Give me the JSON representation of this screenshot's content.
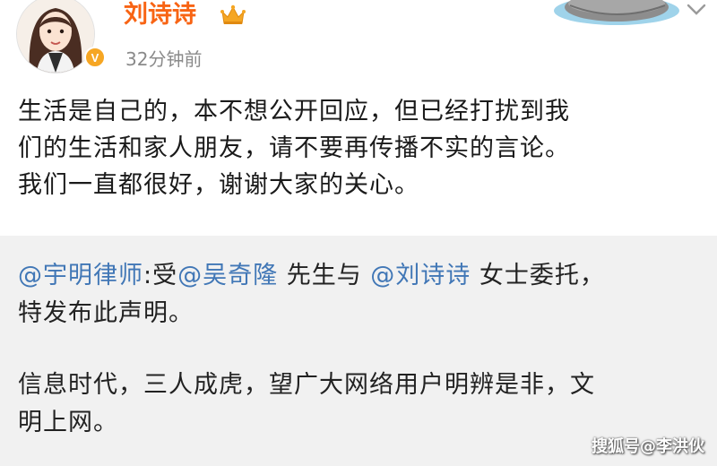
{
  "post": {
    "author": "刘诗诗",
    "timestamp": "32分钟前",
    "verified_badge": "V",
    "body_lines": [
      "生活是自己的，本不想公开回应，但已经打扰到我",
      "们的生活和家人朋友，请不要再传播不实的言论。",
      "我们一直都很好，谢谢大家的关心。"
    ]
  },
  "repost": {
    "author_mention": "@宇明律师",
    "seg1": ":受",
    "mention_1": "@吴奇隆",
    "seg2": " 先生与 ",
    "mention_2": "@刘诗诗",
    "seg3": " 女士委托，",
    "line2": "特发布此声明。",
    "para2_line1": "信息时代，三人成虎，望广大网络用户明辨是非，文",
    "para2_line2": "明上网。"
  },
  "watermark": "搜狐号@李洪伙",
  "colors": {
    "username": "#f86414",
    "mention": "#4177b6",
    "repost_bg": "#f1f1f1",
    "timestamp": "#8a8a8a"
  }
}
